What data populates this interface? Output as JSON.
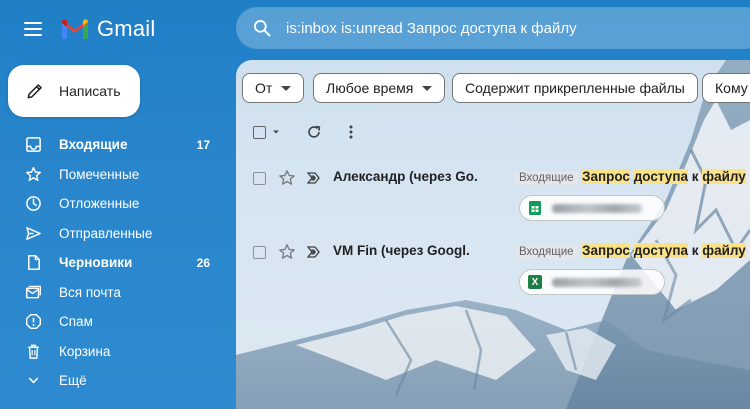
{
  "app": {
    "name": "Gmail"
  },
  "search": {
    "query": "is:inbox is:unread Запрос доступа к файлу"
  },
  "compose": {
    "label": "Написать"
  },
  "sidebar": {
    "items": [
      {
        "icon": "inbox-icon",
        "label": "Входящие",
        "count": "17",
        "bold": true
      },
      {
        "icon": "star-icon",
        "label": "Помеченные",
        "count": "",
        "bold": false
      },
      {
        "icon": "clock-icon",
        "label": "Отложенные",
        "count": "",
        "bold": false
      },
      {
        "icon": "send-icon",
        "label": "Отправленные",
        "count": "",
        "bold": false
      },
      {
        "icon": "draft-icon",
        "label": "Черновики",
        "count": "26",
        "bold": true
      },
      {
        "icon": "all-mail-icon",
        "label": "Вся почта",
        "count": "",
        "bold": false
      },
      {
        "icon": "spam-icon",
        "label": "Спам",
        "count": "",
        "bold": false
      },
      {
        "icon": "trash-icon",
        "label": "Корзина",
        "count": "",
        "bold": false
      },
      {
        "icon": "chevron-down-icon",
        "label": "Ещё",
        "count": "",
        "bold": false
      }
    ]
  },
  "filters": {
    "from": "От",
    "any_time": "Любое время",
    "has_attachment": "Содержит прикрепленные файлы",
    "to": "Кому"
  },
  "emails": [
    {
      "sender": "Александр (через Go.",
      "tag": "Входящие",
      "subject_parts": [
        "Запрос",
        "доступа",
        "к",
        "файлу",
        "\""
      ],
      "attachment_type": "sheets",
      "attachment_icon_color": "#0f9d58"
    },
    {
      "sender": "VM Fin (через Googl.",
      "tag": "Входящие",
      "subject_parts": [
        "Запрос",
        "доступа",
        "к",
        "файлу",
        "\""
      ],
      "attachment_type": "excel",
      "attachment_letter": "X",
      "attachment_icon_color": "#1e7e45"
    }
  ],
  "colors": {
    "background": "#2a86cc",
    "highlight": "#fce287",
    "text_dark": "#202124"
  }
}
